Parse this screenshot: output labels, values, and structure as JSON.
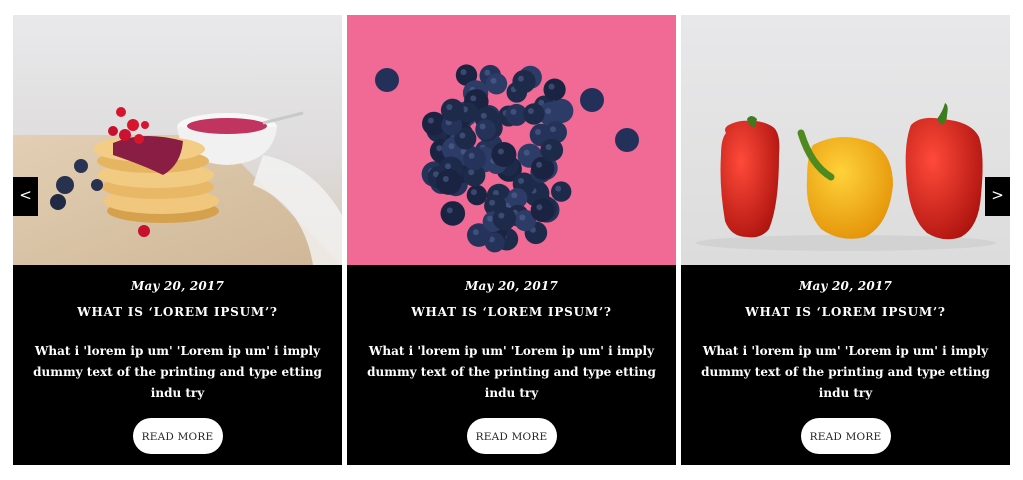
{
  "slider": {
    "prev_label": "<",
    "next_label": ">",
    "cards": [
      {
        "image": "pancakes-with-berries",
        "date": "May 20, 2017",
        "title": "WHAT IS ‘LOREM IPSUM’?",
        "excerpt": "What i 'lorem ip um' 'Lorem ip um' i imply dummy text of the printing and type etting indu try",
        "button": "READ MORE"
      },
      {
        "image": "blueberries-on-pink",
        "date": "May 20, 2017",
        "title": "WHAT IS ‘LOREM IPSUM’?",
        "excerpt": "What i 'lorem ip um' 'Lorem ip um' i imply dummy text of the printing and type etting indu try",
        "button": "READ MORE"
      },
      {
        "image": "bell-peppers",
        "date": "May 20, 2017",
        "title": "WHAT IS ‘LOREM IPSUM’?",
        "excerpt": "What i 'lorem ip um' 'Lorem ip um' i imply dummy text of the printing and type etting indu try",
        "button": "READ MORE"
      }
    ]
  },
  "colors": {
    "card_background": "#000000",
    "button_background": "#ffffff",
    "photo2_background": "#f06a95"
  }
}
